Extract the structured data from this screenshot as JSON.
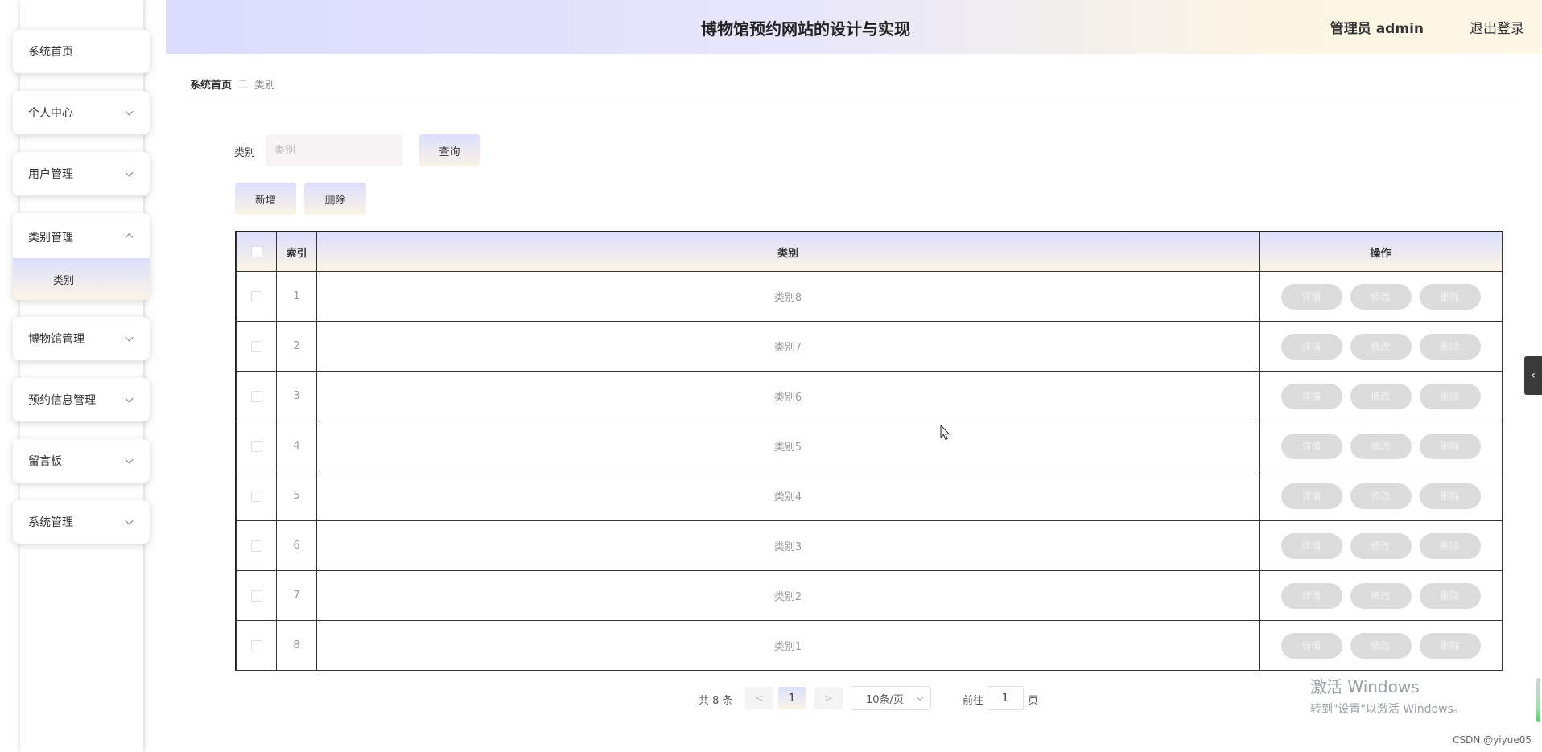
{
  "header": {
    "title": "博物馆预约网站的设计与实现",
    "user": "管理员 admin",
    "logout": "退出登录"
  },
  "sidebar": {
    "items": [
      {
        "label": "系统首页"
      },
      {
        "label": "个人中心"
      },
      {
        "label": "用户管理"
      },
      {
        "label": "类别管理",
        "sub": "类别"
      },
      {
        "label": "博物馆管理"
      },
      {
        "label": "预约信息管理"
      },
      {
        "label": "留言板"
      },
      {
        "label": "系统管理"
      }
    ]
  },
  "breadcrumb": {
    "home": "系统首页",
    "separator": "三",
    "current": "类别"
  },
  "search": {
    "label": "类别",
    "placeholder": "类别",
    "query_button": "查询"
  },
  "actions": {
    "add": "新增",
    "delete": "删除"
  },
  "table": {
    "headers": {
      "index": "索引",
      "category": "类别",
      "ops": "操作"
    },
    "op_labels": {
      "detail": "详情",
      "edit": "修改",
      "delete": "删除"
    },
    "rows": [
      {
        "index": "1",
        "category": "类别8"
      },
      {
        "index": "2",
        "category": "类别7"
      },
      {
        "index": "3",
        "category": "类别6"
      },
      {
        "index": "4",
        "category": "类别5"
      },
      {
        "index": "5",
        "category": "类别4"
      },
      {
        "index": "6",
        "category": "类别3"
      },
      {
        "index": "7",
        "category": "类别2"
      },
      {
        "index": "8",
        "category": "类别1"
      }
    ]
  },
  "pagination": {
    "total": "共 8 条",
    "prev": "<",
    "current": "1",
    "next": ">",
    "page_size": "10条/页",
    "goto_label": "前往",
    "goto_value": "1",
    "page_suffix": "页"
  },
  "watermark": {
    "title": "激活 Windows",
    "subtitle": "转到\"设置\"以激活 Windows。"
  },
  "csdn": "CSDN @yiyue05"
}
